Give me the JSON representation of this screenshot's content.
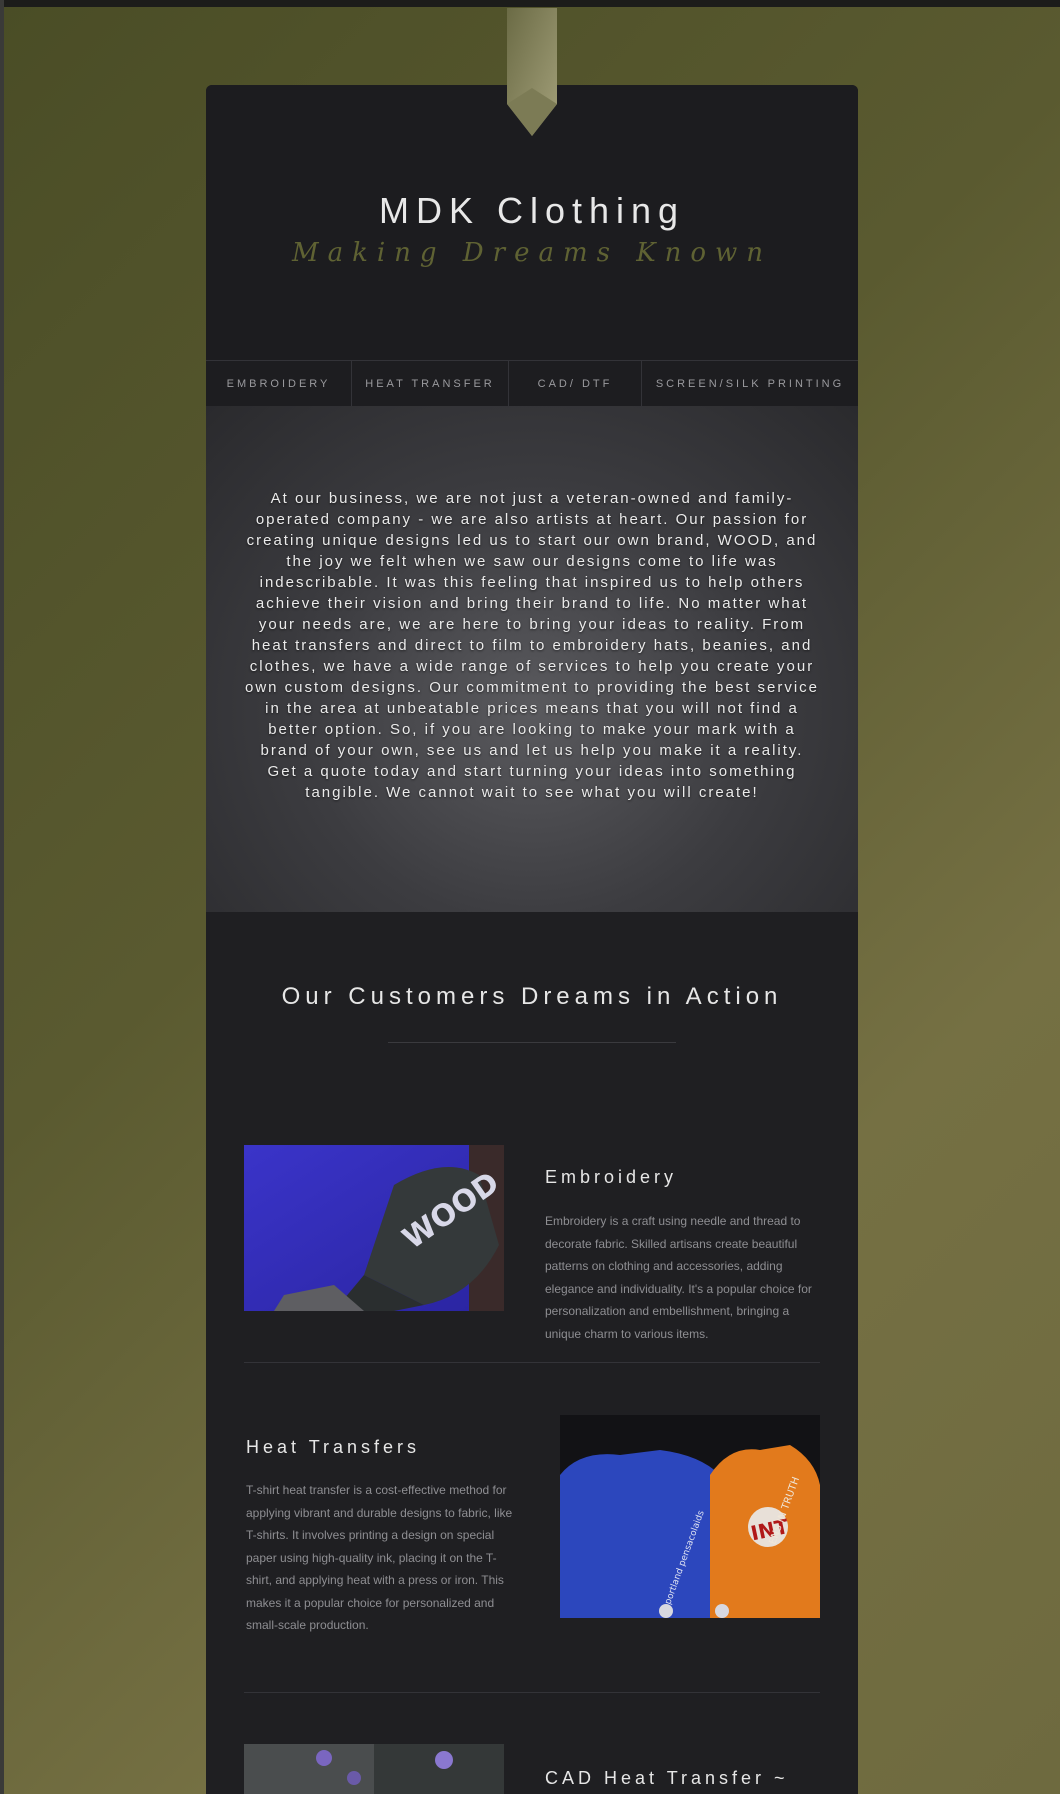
{
  "site": {
    "title": "MDK Clothing",
    "tagline": "Making Dreams Known"
  },
  "nav": {
    "items": [
      {
        "label": "EMBROIDERY"
      },
      {
        "label": "HEAT TRANSFER"
      },
      {
        "label": "CAD/ DTF"
      },
      {
        "label": "SCREEN/SILK PRINTING"
      }
    ]
  },
  "hero": {
    "text": "At our business, we are not just a veteran-owned and family-operated company - we are also artists at heart. Our passion for creating unique designs led us to start our own brand, WOOD, and the joy we felt when we saw our designs come to life was indescribable. It was this feeling that inspired us to help others achieve their vision and bring their brand to life. No matter what your needs are, we are here to bring your ideas to reality. From heat transfers and direct to film to embroidery hats, beanies, and clothes, we have a wide range of services to help you create your own custom designs. Our commitment to providing the best service in the area at unbeatable prices means that you will not find a better option. So, if you are looking to make your mark with a brand of your own, see us and let us help you make it a reality. Get a quote today and start turning your ideas into something tangible. We cannot wait to see what you will create!"
  },
  "showcase": {
    "title": "Our Customers Dreams in Action",
    "features": [
      {
        "title": "Embroidery",
        "description": "Embroidery is a craft using needle and thread to decorate fabric. Skilled artisans create beautiful patterns on clothing and accessories, adding elegance and individuality. It's a popular choice for personalization and embellishment, bringing a unique charm to various items.",
        "image_text": "WOOD"
      },
      {
        "title": "Heat Transfers",
        "description": "T-shirt heat transfer is a cost-effective method for applying vibrant and durable designs to fabric, like T-shirts. It involves printing a design on special paper using high-quality ink, placing it on the T-shirt, and applying heat with a press or iron. This makes it a popular choice for personalized and small-scale production.",
        "image_text_1": "portland pensacolaids",
        "image_text_2": "INT",
        "image_text_3": "ENS IN TRUTH"
      },
      {
        "title": "CAD Heat Transfer ~"
      }
    ]
  },
  "colors": {
    "background": "#5a5a30",
    "card": "#1f1f22",
    "tagline": "#5f6233",
    "accent_ribbon": "#8a8a62"
  }
}
